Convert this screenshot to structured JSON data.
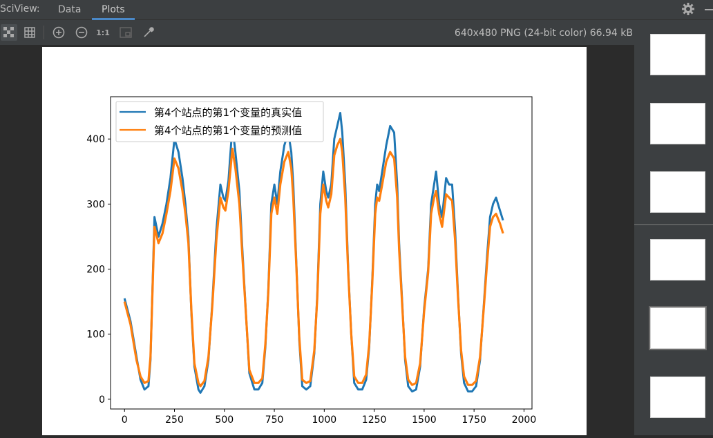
{
  "app": {
    "title": "SciView:",
    "tabs": [
      {
        "label": "Data",
        "active": false
      },
      {
        "label": "Plots",
        "active": true
      }
    ]
  },
  "toolbar": {
    "image_info": "640x480 PNG (24-bit color) 66.94 kB",
    "actual_size_label": "1:1",
    "icons": [
      "chessboard-icon",
      "grid-icon",
      "zoom-in-icon",
      "zoom-out-icon",
      "actual-size-icon",
      "fit-to-window-icon",
      "color-picker-icon",
      "gear-icon",
      "minimize-icon"
    ]
  },
  "colors": {
    "accent": "#4a88c7",
    "series_true": "#1f77b4",
    "series_pred": "#ff7f0e"
  },
  "chart_data": {
    "type": "line",
    "title": "",
    "xlabel": "",
    "ylabel": "",
    "xlim": [
      -70,
      2040
    ],
    "ylim": [
      -15,
      465
    ],
    "xticks": [
      0,
      250,
      500,
      750,
      1000,
      1250,
      1500,
      1750,
      2000
    ],
    "yticks": [
      0,
      100,
      200,
      300,
      400
    ],
    "legend_position": "top-left",
    "grid": false,
    "x": [
      0,
      30,
      60,
      80,
      100,
      120,
      130,
      140,
      150,
      170,
      190,
      210,
      230,
      250,
      270,
      290,
      305,
      320,
      335,
      350,
      370,
      380,
      400,
      420,
      440,
      460,
      480,
      495,
      505,
      520,
      540,
      555,
      575,
      590,
      610,
      625,
      650,
      670,
      690,
      705,
      720,
      735,
      750,
      765,
      780,
      800,
      820,
      835,
      845,
      860,
      875,
      890,
      910,
      930,
      950,
      965,
      980,
      995,
      1010,
      1020,
      1035,
      1050,
      1065,
      1080,
      1090,
      1105,
      1120,
      1135,
      1150,
      1170,
      1190,
      1210,
      1225,
      1240,
      1255,
      1265,
      1275,
      1290,
      1310,
      1330,
      1350,
      1365,
      1375,
      1390,
      1405,
      1420,
      1440,
      1460,
      1480,
      1500,
      1520,
      1535,
      1550,
      1560,
      1575,
      1590,
      1610,
      1625,
      1640,
      1655,
      1670,
      1685,
      1700,
      1720,
      1740,
      1760,
      1780,
      1800,
      1815,
      1830,
      1845,
      1860,
      1880,
      1895,
      1910,
      1925,
      1940,
      1955,
      1965
    ],
    "series": [
      {
        "name": "第4个站点的第1个变量的真实值",
        "values": [
          155,
          120,
          65,
          30,
          15,
          20,
          60,
          170,
          280,
          250,
          270,
          300,
          340,
          400,
          380,
          340,
          300,
          250,
          130,
          50,
          15,
          10,
          20,
          60,
          150,
          260,
          330,
          310,
          305,
          335,
          420,
          380,
          320,
          230,
          120,
          40,
          15,
          15,
          25,
          80,
          170,
          300,
          330,
          300,
          350,
          390,
          410,
          380,
          330,
          210,
          90,
          20,
          15,
          20,
          70,
          160,
          300,
          350,
          320,
          310,
          330,
          400,
          420,
          440,
          410,
          330,
          200,
          100,
          25,
          15,
          15,
          30,
          80,
          180,
          300,
          330,
          320,
          350,
          390,
          420,
          410,
          330,
          240,
          150,
          60,
          20,
          12,
          15,
          50,
          140,
          200,
          300,
          330,
          350,
          300,
          280,
          340,
          330,
          330,
          260,
          160,
          70,
          25,
          12,
          12,
          20,
          60,
          150,
          220,
          280,
          300,
          310,
          290,
          275
        ]
      },
      {
        "name": "第4个站点的第1个变量的预测值",
        "values": [
          150,
          115,
          60,
          35,
          25,
          28,
          65,
          165,
          265,
          240,
          255,
          285,
          320,
          370,
          355,
          320,
          285,
          240,
          135,
          55,
          25,
          20,
          28,
          65,
          145,
          245,
          310,
          295,
          290,
          320,
          385,
          355,
          300,
          220,
          120,
          45,
          25,
          25,
          32,
          85,
          165,
          285,
          310,
          285,
          330,
          365,
          380,
          355,
          310,
          205,
          95,
          30,
          25,
          28,
          75,
          155,
          285,
          330,
          305,
          295,
          315,
          375,
          390,
          400,
          380,
          310,
          195,
          100,
          35,
          25,
          25,
          38,
          85,
          175,
          285,
          310,
          305,
          330,
          365,
          380,
          370,
          310,
          230,
          145,
          65,
          30,
          22,
          25,
          55,
          135,
          195,
          285,
          310,
          320,
          285,
          265,
          315,
          310,
          305,
          245,
          155,
          75,
          35,
          22,
          22,
          28,
          65,
          145,
          210,
          265,
          280,
          285,
          270,
          255
        ]
      }
    ]
  },
  "thumbnails": [
    {
      "active": false
    },
    {
      "active": false
    },
    {
      "active": false
    },
    {
      "active": false
    },
    {
      "active": true
    },
    {
      "active": false
    },
    {
      "active": false
    }
  ]
}
